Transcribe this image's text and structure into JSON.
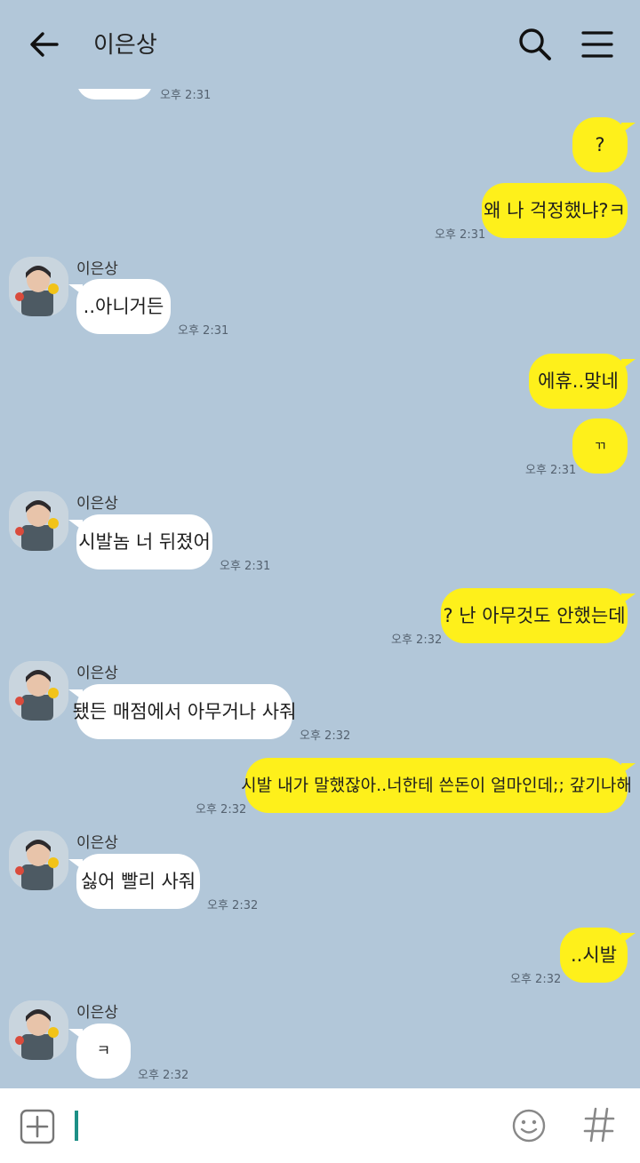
{
  "header": {
    "title": "이은상",
    "back_icon": "arrow-left-icon",
    "search_icon": "search-icon",
    "menu_icon": "hamburger-menu-icon"
  },
  "messages": [
    {
      "dir": "in",
      "text": "",
      "time": "오후 2:31"
    },
    {
      "dir": "out",
      "text": "?",
      "time": ""
    },
    {
      "dir": "out",
      "text": "왜 나 걱정했냐?ㅋ",
      "time": "오후 2:31"
    },
    {
      "dir": "in",
      "sender": "이은상",
      "text": "..아니거든",
      "time": "오후 2:31"
    },
    {
      "dir": "out",
      "text": "에휴..맞네",
      "time": ""
    },
    {
      "dir": "out",
      "text": "ㄲ",
      "time": "오후 2:31"
    },
    {
      "dir": "in",
      "sender": "이은상",
      "text": "시발놈 너 뒤졌어",
      "time": "오후 2:31"
    },
    {
      "dir": "out",
      "text": "? 난 아무것도 안했는데",
      "time": "오후 2:32"
    },
    {
      "dir": "in",
      "sender": "이은상",
      "text": "됐든 매점에서 아무거나 사줘",
      "time": "오후 2:32"
    },
    {
      "dir": "out",
      "text": "시발 내가 말했잖아..너한테 쓴돈이 얼마인데;; 갚기나해",
      "time": "오후 2:32"
    },
    {
      "dir": "in",
      "sender": "이은상",
      "text": "싫어 빨리 사줘",
      "time": "오후 2:32"
    },
    {
      "dir": "out",
      "text": "..시발",
      "time": "오후 2:32"
    },
    {
      "dir": "in",
      "sender": "이은상",
      "text": "ㅋ",
      "time": "오후 2:32"
    }
  ],
  "input_bar": {
    "plus_icon": "plus-box-icon",
    "emoji_icon": "smiley-icon",
    "hash_icon": "hashtag-icon"
  },
  "colors": {
    "background": "#b2c7d9",
    "outgoing_bubble": "#fef01b",
    "incoming_bubble": "#ffffff",
    "cursor": "#1d8f86"
  }
}
